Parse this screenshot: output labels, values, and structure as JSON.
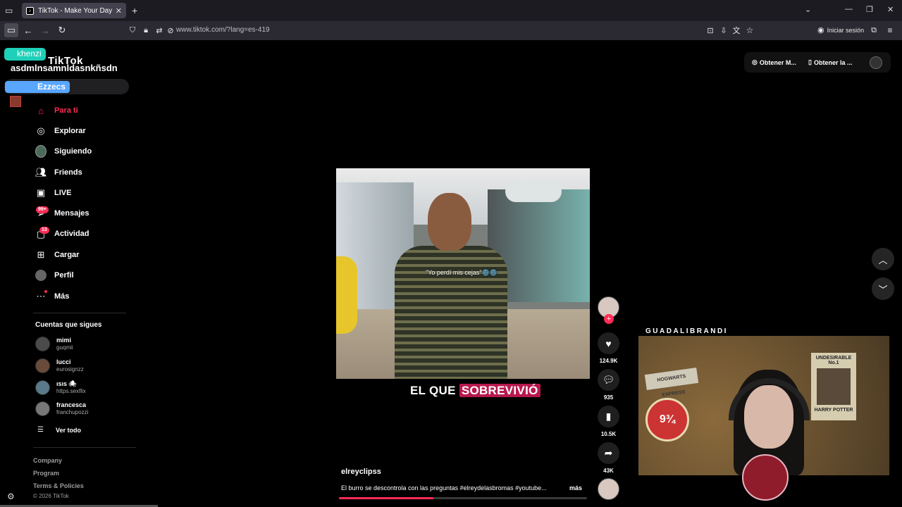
{
  "browser": {
    "tab_title": "TikTok - Make Your Day",
    "url": "www.tiktok.com/?lang=es-419",
    "signin_label": "Iniciar sesión"
  },
  "overlay": {
    "tag1": "khenzi",
    "brand": "TikTok",
    "user_text": "asdmlnsamnldasnkñsdn",
    "tag2": "Ezzecs"
  },
  "sidebar": {
    "items": [
      {
        "label": "Para ti",
        "icon": "home-icon"
      },
      {
        "label": "Explorar",
        "icon": "compass-icon"
      },
      {
        "label": "Siguiendo",
        "icon": "following-avatar-icon"
      },
      {
        "label": "Friends",
        "icon": "friends-icon"
      },
      {
        "label": "LIVE",
        "icon": "live-tv-icon"
      },
      {
        "label": "Mensajes",
        "icon": "send-icon",
        "badge": "99+"
      },
      {
        "label": "Actividad",
        "icon": "inbox-icon",
        "badge": "13"
      },
      {
        "label": "Cargar",
        "icon": "plus-square-icon"
      },
      {
        "label": "Perfil",
        "icon": "profile-icon"
      },
      {
        "label": "Más",
        "icon": "more-dots-icon"
      }
    ],
    "following_title": "Cuentas que sigues",
    "accounts": [
      {
        "name": "mimi",
        "handle": "guqmii"
      },
      {
        "name": "lucci",
        "handle": "eurosignzz"
      },
      {
        "name": "ısıs 🕷",
        "handle": "https.sexflix"
      },
      {
        "name": "francesca",
        "handle": "franchupozzi"
      }
    ],
    "see_all": "Ver todo",
    "footer_links": [
      "Company",
      "Program",
      "Terms & Policies"
    ],
    "copyright": "© 2026 TikTok"
  },
  "topright": {
    "btn1": "Obtener M...",
    "btn2": "Obtener la ..."
  },
  "video": {
    "inner_caption": "\"Yo perdí mis cejas\"🌚🌚",
    "subtitle_plain": "EL QUE",
    "subtitle_highlight": "SOBREVIVIÓ",
    "author": "elreyclipss",
    "description": "El burro se descontrola con las preguntas #elreydelasbromas #youtube...",
    "more_label": "más",
    "progress": 0.38
  },
  "actions": {
    "likes": "124.9K",
    "comments": "935",
    "saves": "10.5K",
    "shares": "43K"
  },
  "webcam": {
    "label": "GUADALIBRANDI",
    "sign_text": "HOGWARTS EXPRESS",
    "platform_text": "9¾",
    "poster_title": "UNDESIRABLE No.1",
    "poster_name": "HARRY POTTER"
  },
  "colors": {
    "accent": "#fe2c55",
    "overlay_teal": "#1fd0b8",
    "overlay_blue": "#58a6ff"
  }
}
